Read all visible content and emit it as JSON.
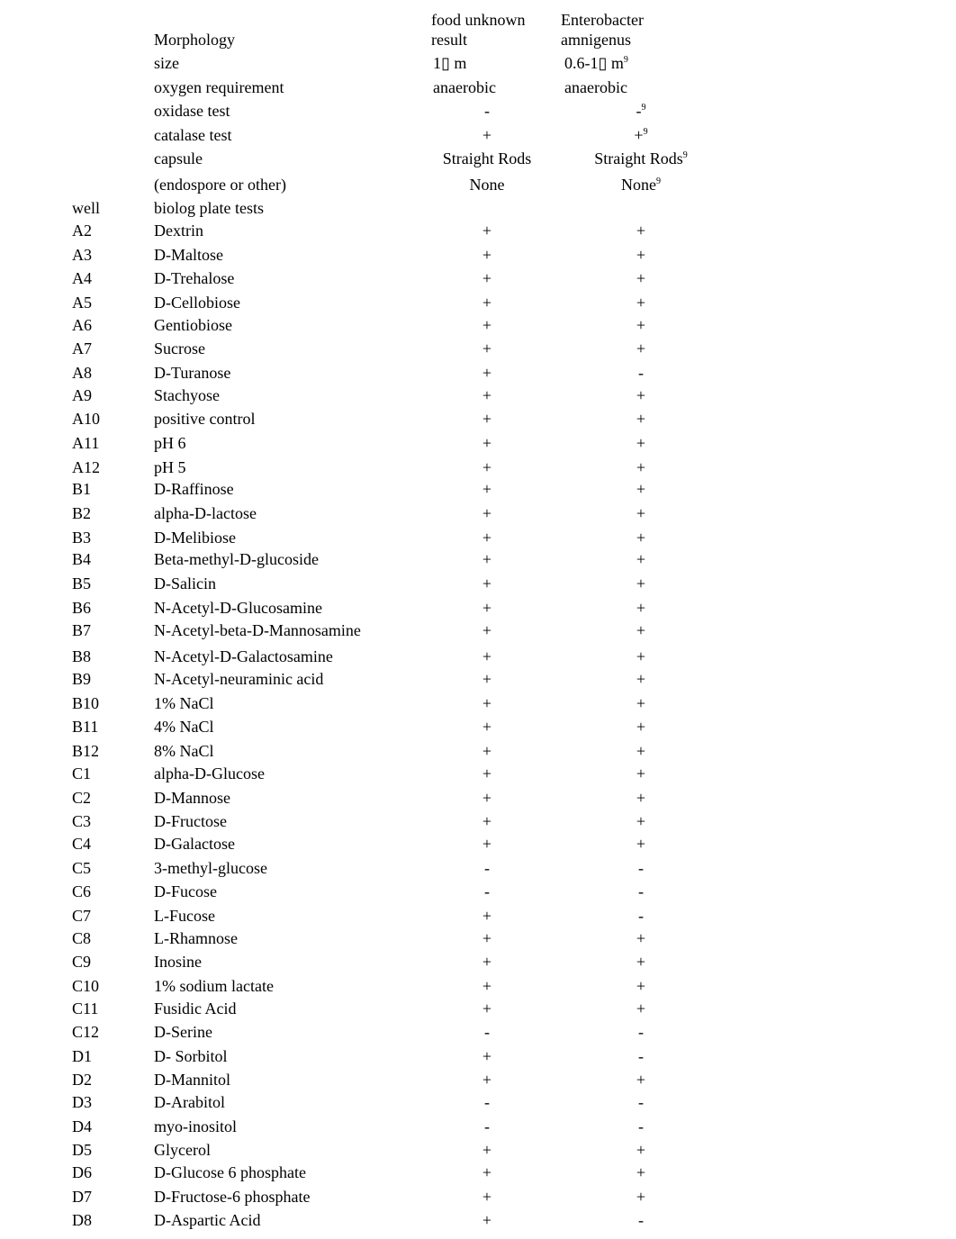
{
  "header": {
    "col1_line1": "food unknown",
    "col1_line2": "result",
    "col2_line1": "Enterobacter",
    "col2_line2": "amnigenus",
    "section_morphology": "Morphology",
    "well_label": "well",
    "section_biolog": "biolog plate tests"
  },
  "morphology": [
    {
      "test": "size",
      "unknown": "1▯ m",
      "reference": "0.6-1▯ m",
      "ref_note": "9"
    },
    {
      "test": "oxygen requirement",
      "unknown": "anaerobic",
      "reference": "anaerobic",
      "ref_note": ""
    },
    {
      "test": "oxidase test",
      "unknown": "-",
      "reference": "-",
      "ref_note": "9"
    },
    {
      "test": "catalase test",
      "unknown": "+",
      "reference": "+",
      "ref_note": "9"
    },
    {
      "test": "capsule",
      "unknown": "Straight Rods",
      "reference": "Straight Rods",
      "ref_note": "9"
    },
    {
      "test": "(endospore or other)",
      "unknown": "None",
      "reference": "None",
      "ref_note": "9"
    }
  ],
  "biolog": [
    [
      "A2",
      "Dextrin",
      "+",
      "+"
    ],
    [
      "A3",
      "D-Maltose",
      "+",
      "+"
    ],
    [
      "A4",
      "D-Trehalose",
      "+",
      "+"
    ],
    [
      "A5",
      "D-Cellobiose",
      "+",
      "+"
    ],
    [
      "A6",
      "Gentiobiose",
      "+",
      "+"
    ],
    [
      "A7",
      "Sucrose",
      "+",
      "+"
    ],
    [
      "A8",
      "D-Turanose",
      "+",
      "-"
    ],
    [
      "A9",
      "Stachyose",
      "+",
      "+"
    ],
    [
      "A10",
      "positive control",
      "+",
      "+"
    ],
    [
      "A11",
      "pH 6",
      "+",
      "+"
    ],
    [
      "A12",
      "pH 5",
      "+",
      "+"
    ],
    [
      "B1",
      "D-Raffinose",
      "+",
      "+"
    ],
    [
      "B2",
      "alpha-D-lactose",
      "+",
      "+"
    ],
    [
      "B3",
      "D-Melibiose",
      "+",
      "+"
    ],
    [
      "B4",
      "Beta-methyl-D-glucoside",
      "+",
      "+"
    ],
    [
      "B5",
      "D-Salicin",
      "+",
      "+"
    ],
    [
      "B6",
      "N-Acetyl-D-Glucosamine",
      "+",
      "+"
    ],
    [
      "B7",
      "N-Acetyl-beta-D-Mannosamine",
      "+",
      "+"
    ],
    [
      "B8",
      "N-Acetyl-D-Galactosamine",
      "+",
      "+"
    ],
    [
      "B9",
      "N-Acetyl-neuraminic acid",
      "+",
      "+"
    ],
    [
      "B10",
      "1% NaCl",
      "+",
      "+"
    ],
    [
      "B11",
      "4% NaCl",
      "+",
      "+"
    ],
    [
      "B12",
      "8% NaCl",
      "+",
      "+"
    ],
    [
      "C1",
      "alpha-D-Glucose",
      "+",
      "+"
    ],
    [
      "C2",
      "D-Mannose",
      "+",
      "+"
    ],
    [
      "C3",
      "D-Fructose",
      "+",
      "+"
    ],
    [
      "C4",
      "D-Galactose",
      "+",
      "+"
    ],
    [
      "C5",
      "3-methyl-glucose",
      "-",
      "-"
    ],
    [
      "C6",
      "D-Fucose",
      "-",
      "-"
    ],
    [
      "C7",
      "L-Fucose",
      "+",
      "-"
    ],
    [
      "C8",
      "L-Rhamnose",
      "+",
      "+"
    ],
    [
      "C9",
      "Inosine",
      "+",
      "+"
    ],
    [
      "C10",
      "1% sodium lactate",
      "+",
      "+"
    ],
    [
      "C11",
      "Fusidic Acid",
      "+",
      "+"
    ],
    [
      "C12",
      "D-Serine",
      "-",
      "-"
    ],
    [
      "D1",
      "D- Sorbitol",
      "+",
      "-"
    ],
    [
      "D2",
      "D-Mannitol",
      "+",
      "+"
    ],
    [
      "D3",
      "D-Arabitol",
      "-",
      "-"
    ],
    [
      "D4",
      "myo-inositol",
      "-",
      "-"
    ],
    [
      "D5",
      "Glycerol",
      "+",
      "+"
    ],
    [
      "D6",
      "D-Glucose 6 phosphate",
      "+",
      "+"
    ],
    [
      "D7",
      "D-Fructose-6 phosphate",
      "+",
      "+"
    ],
    [
      "D8",
      "D-Aspartic Acid",
      "+",
      "-"
    ]
  ]
}
